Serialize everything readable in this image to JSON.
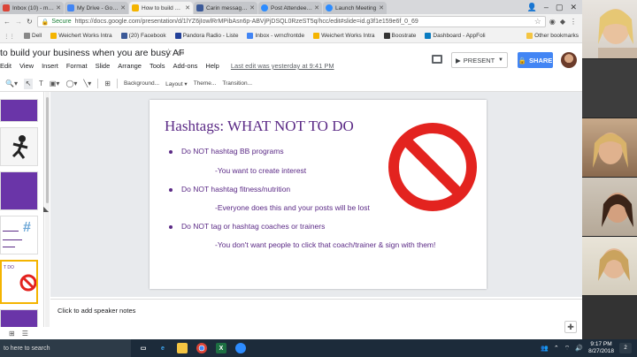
{
  "browser": {
    "tabs": [
      {
        "label": "Inbox (10) - mom",
        "color": "#db4437",
        "active": false
      },
      {
        "label": "My Drive - Google",
        "color": "#4285f4",
        "active": false
      },
      {
        "label": "How to build your",
        "color": "#f4b400",
        "active": true
      },
      {
        "label": "Carin messaged h",
        "color": "#3b5998",
        "active": false
      },
      {
        "label": "Post Attendee - Z",
        "color": "#2d8cff",
        "active": false
      },
      {
        "label": "Launch Meeting",
        "color": "#2d8cff",
        "active": false
      }
    ],
    "secure_label": "Secure",
    "url": "https://docs.google.com/presentation/d/1lYZ6jIowlRrMPibAsn6p-ABVjPjDSQL0RzeST5q/hcc/edit#slide=id.g3f1e159e6f_0_69",
    "bookmarks": [
      {
        "label": "Dell",
        "color": "#888"
      },
      {
        "label": "Weichert Works Intra",
        "color": "#f4b400"
      },
      {
        "label": "(20) Facebook",
        "color": "#3b5998"
      },
      {
        "label": "Pandora Radio - Liste",
        "color": "#224099"
      },
      {
        "label": "Inbox - wrncfrontde",
        "color": "#4285f4"
      },
      {
        "label": "Weichert Works Intra",
        "color": "#f4b400"
      },
      {
        "label": "Boostrate",
        "color": "#333"
      },
      {
        "label": "Dashboard - AppFoli",
        "color": "#0a7cc1"
      }
    ],
    "other_bookmarks": "Other bookmarks"
  },
  "doc": {
    "title": "to build your business when you are busy AF",
    "menu": [
      "Edit",
      "View",
      "Insert",
      "Format",
      "Slide",
      "Arrange",
      "Tools",
      "Add-ons",
      "Help"
    ],
    "last_edit": "Last edit was yesterday at 9:41 PM",
    "present_label": "PRESENT",
    "share_label": "SHARE"
  },
  "toolbar": {
    "background_label": "Background...",
    "layout_label": "Layout",
    "theme_label": "Theme...",
    "transition_label": "Transition..."
  },
  "slide": {
    "title": "Hashtags: WHAT NOT TO DO",
    "bullets": [
      {
        "text": "Do NOT hashtag BB programs",
        "sub": "-You want to create interest"
      },
      {
        "text": "Do NOT hashtag fitness/nutrition",
        "sub": "-Everyone does this and your posts will be lost"
      },
      {
        "text": "Do NOT tag or hashtag coaches or trainers",
        "sub": "-You don't want people to click that coach/trainer & sign with them!"
      }
    ],
    "title_color": "#5b2a86",
    "sign_color": "#e3231f"
  },
  "filmstrip": {
    "thumb_labels": [
      "T DO",
      "#"
    ]
  },
  "notes": {
    "placeholder": "Click to add speaker notes"
  },
  "taskbar": {
    "search_label": "to here to search",
    "time": "9:17 PM",
    "date": "8/27/2018",
    "notification_count": "2"
  }
}
